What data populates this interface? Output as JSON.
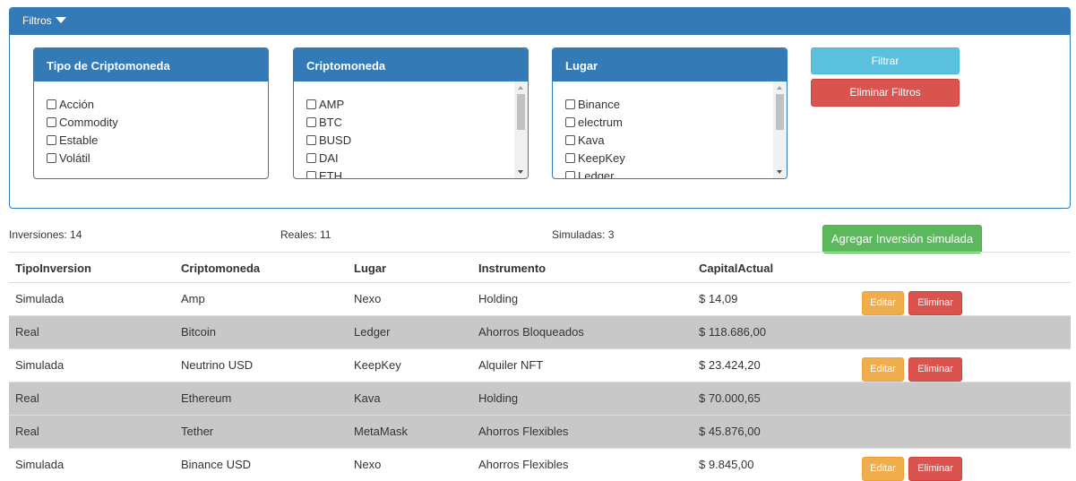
{
  "filters": {
    "title": "Filtros",
    "boxes": [
      {
        "title": "Tipo de Criptomoneda",
        "options": [
          "Acción",
          "Commodity",
          "Estable",
          "Volátil"
        ]
      },
      {
        "title": "Criptomoneda",
        "options": [
          "AMP",
          "BTC",
          "BUSD",
          "DAI",
          "ETH"
        ]
      },
      {
        "title": "Lugar",
        "options": [
          "Binance",
          "electrum",
          "Kava",
          "KeepKey",
          "Ledger"
        ]
      }
    ],
    "filter_button": "Filtrar",
    "clear_button": "Eliminar Filtros"
  },
  "summary": {
    "total": "Inversiones: 14",
    "real": "Reales: 11",
    "simulated": "Simuladas: 3",
    "add_button": "Agregar Inversión simulada"
  },
  "table": {
    "headers": [
      "TipoInversion",
      "Criptomoneda",
      "Lugar",
      "Instrumento",
      "CapitalActual"
    ],
    "rows": [
      {
        "tipo": "Simulada",
        "cripto": "Amp",
        "lugar": "Nexo",
        "instrumento": "Holding",
        "capital": "$ 14,09",
        "edit": "Editar",
        "delete": "Eliminar"
      },
      {
        "tipo": "Real",
        "cripto": "Bitcoin",
        "lugar": "Ledger",
        "instrumento": "Ahorros Bloqueados",
        "capital": "$ 118.686,00"
      },
      {
        "tipo": "Simulada",
        "cripto": "Neutrino USD",
        "lugar": "KeepKey",
        "instrumento": "Alquiler NFT",
        "capital": "$ 23.424,20",
        "edit": "Editar",
        "delete": "Eliminar"
      },
      {
        "tipo": "Real",
        "cripto": "Ethereum",
        "lugar": "Kava",
        "instrumento": "Holding",
        "capital": "$ 70.000,65"
      },
      {
        "tipo": "Real",
        "cripto": "Tether",
        "lugar": "MetaMask",
        "instrumento": "Ahorros Flexibles",
        "capital": "$ 45.876,00"
      },
      {
        "tipo": "Simulada",
        "cripto": "Binance USD",
        "lugar": "Nexo",
        "instrumento": "Ahorros Flexibles",
        "capital": "$ 9.845,00",
        "edit": "Editar",
        "delete": "Eliminar"
      }
    ]
  },
  "colors": {
    "primary": "#337ab7",
    "info": "#5bc0de",
    "danger": "#d9534f",
    "success": "#5cb85c",
    "warning": "#f0ad4e",
    "row_highlight": "#c8c8c8"
  }
}
